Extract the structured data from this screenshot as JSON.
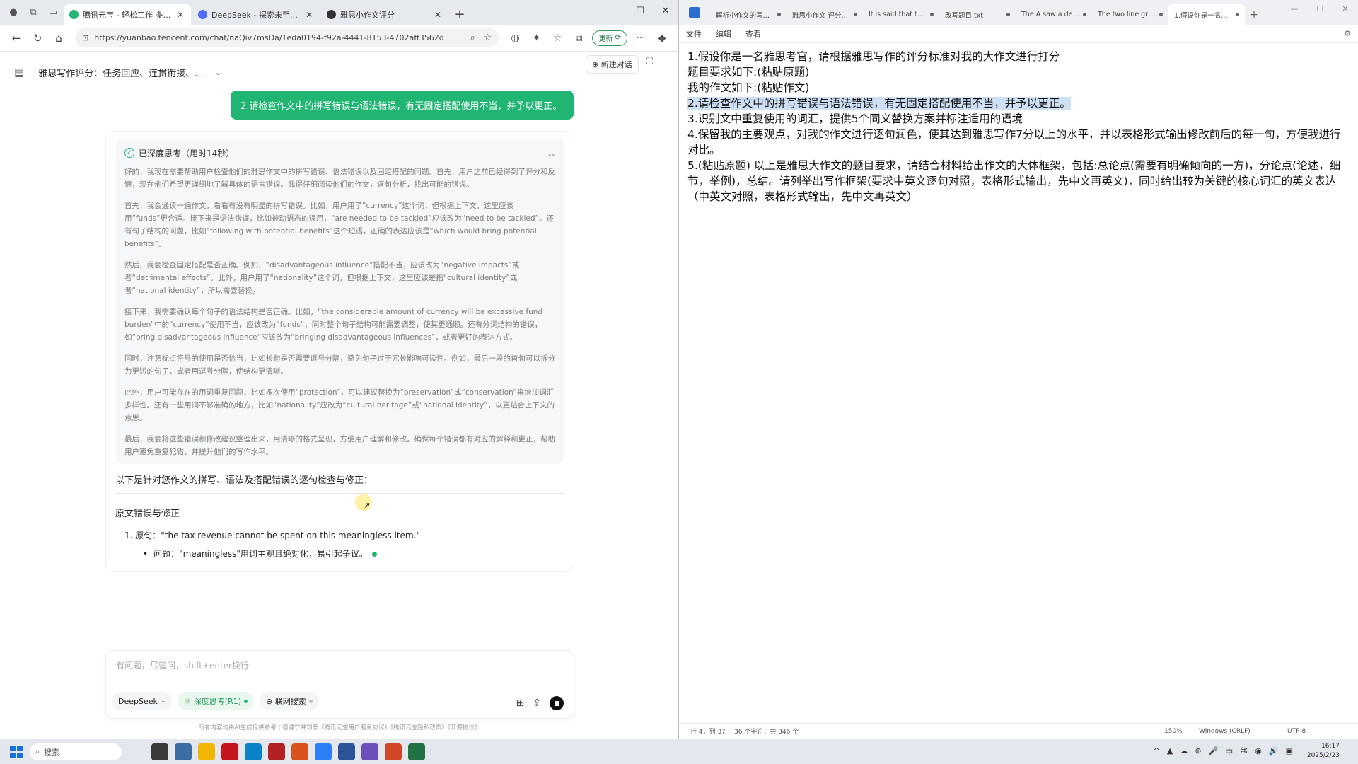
{
  "browser": {
    "tabs": [
      {
        "label": "腾讯元宝 - 轻松工作 多点生活",
        "color": "#21b573",
        "active": true
      },
      {
        "label": "DeepSeek - 探索未至之境",
        "color": "#4d6bfe",
        "active": false
      },
      {
        "label": "雅思小作文评分",
        "color": "#333333",
        "active": false
      }
    ],
    "close_glyph": "✕",
    "new_tab_glyph": "+",
    "url": "https://yuanbao.tencent.com/chat/naQiv7msDa/1eda0194-f92a-4441-8153-4702aff3562d",
    "update_label": "更新"
  },
  "chat": {
    "title": "雅思写作评分：任务回应、连贯衔接、...",
    "new_chat_label": "新建对话",
    "user_message": "2.请检查作文中的拼写错误与语法错误，有无固定搭配使用不当，并予以更正。",
    "thinking": {
      "header": "已深度思考（用时14秒）",
      "paragraphs": [
        "好的，我现在需要帮助用户检查他们的雅思作文中的拼写错误、语法错误以及固定搭配的问题。首先，用户之前已经得到了评分和反馈，现在他们希望更详细地了解具体的语言错误。我得仔细阅读他们的作文，逐句分析，找出可能的错误。",
        "首先，我会通读一遍作文，看看有没有明显的拼写错误。比如，用户用了“currency”这个词，但根据上下文，这里应该用“funds”更合适。接下来是语法错误，比如被动语态的误用，“are needed to be tackled”应该改为“need to be tackled”。还有句子结构的问题，比如“following with potential benefits”这个短语，正确的表达应该是“which would bring potential benefits”。",
        "然后，我会检查固定搭配是否正确。例如，“disadvantageous influence”搭配不当，应该改为“negative impacts”或者“detrimental effects”。此外，用户用了“nationality”这个词，但根据上下文，这里应该是指“cultural identity”或者“national identity”，所以需要替换。",
        "接下来，我需要确认每个句子的语法结构是否正确。比如，“the considerable amount of currency will be excessive fund burden”中的“currency”使用不当，应该改为“funds”，同时整个句子结构可能需要调整，使其更通顺。还有分词结构的错误，如“bring disadvantageous influence”应该改为“bringing disadvantageous influences”，或者更好的表达方式。",
        "同时，注意标点符号的使用是否恰当，比如长句是否需要逗号分隔，避免句子过于冗长影响可读性。例如，最后一段的首句可以拆分为更短的句子，或者用逗号分隔，使结构更清晰。",
        "此外，用户可能存在的用词重复问题，比如多次使用“protection”，可以建议替换为“preservation”或“conservation”来增加词汇多样性。还有一些用词不够准确的地方，比如“nationality”应改为“cultural heritage”或“national identity”，以更贴合上下文的意思。",
        "最后，我会将这些错误和修改建议整理出来，用清晰的格式呈现，方便用户理解和修改。确保每个错误都有对应的解释和更正，帮助用户避免重复犯错，并提升他们的写作水平。"
      ]
    },
    "answer_lead": "以下是针对您作文的拼写、语法及搭配错误的逐句检查与修正：",
    "section_heading": "原文错误与修正",
    "item_1": "1. 原句：\"the tax revenue cannot be spent on this meaningless item.\"",
    "item_1_issue": "问题：\"meaningless\"用词主观且绝对化，易引起争议。",
    "input_placeholder": "有问题，尽管问，shift+enter换行",
    "chips": {
      "model": "DeepSeek",
      "deep_think": "深度思考(R1)",
      "web_search": "联网搜索"
    },
    "footer": "所有内容均由AI生成仅供参考 | 请遵守并知悉《腾讯元宝用户服务协议》《腾讯元宝隐私政策》《开源协议》"
  },
  "notepad": {
    "tabs": [
      "解析小作文的写作...",
      "雅思小作文 评分要求",
      "It is said that the a",
      "改写题目.txt",
      "The A saw a decrea",
      "The two line graph",
      "1.假设你是一名雅..."
    ],
    "menu": [
      "文件",
      "编辑",
      "查看"
    ],
    "lines": [
      "1.假设你是一名雅思考官，请根据雅思写作的评分标准对我的大作文进行打分",
      "题目要求如下:(粘贴原题)",
      "我的作文如下:(粘贴作文)",
      "2.请检查作文中的拼写错误与语法错误，有无固定搭配使用不当，并予以更正。",
      "3.识别文中重复使用的词汇，提供5个同义替换方案并标注适用的语境",
      "4.保留我的主要观点，对我的作文进行逐句润色，使其达到雅思写作7分以上的水平，并以表格形式输出修改前后的每一句，方便我进行对比。",
      "5.(粘贴原题) 以上是雅思大作文的题目要求，请结合材料给出作文的大体框架，包括:总论点(需要有明确倾向的一方)，分论点(论述，细节，举例)，总结。请列举出写作框架(要求中英文逐句对照，表格形式输出，先中文再英文)，同时给出较为关键的核心词汇的英文表达（中英文对照，表格形式输出，先中文再英文）"
    ],
    "status": {
      "position": "行 4，列 37",
      "chars": "36 个字符，共 346 个",
      "zoom": "150%",
      "eol": "Windows (CRLF)",
      "encoding": "UTF-8"
    }
  },
  "taskbar": {
    "search_label": "搜索",
    "time": "16:17",
    "date": "2025/2/23",
    "app_colors": [
      "#3b3b3b",
      "#3a6ea5",
      "#f2b705",
      "#c4161c",
      "#0a84c6",
      "#b22222",
      "#d9531e",
      "#2d7ff9",
      "#2b579a",
      "#6b4fbb",
      "#d24726",
      "#217346"
    ],
    "tray_icons": [
      "^",
      "▲",
      "☁",
      "⊕",
      "🎤",
      "中",
      "⌘",
      "◉",
      "🔊",
      "▣"
    ]
  }
}
